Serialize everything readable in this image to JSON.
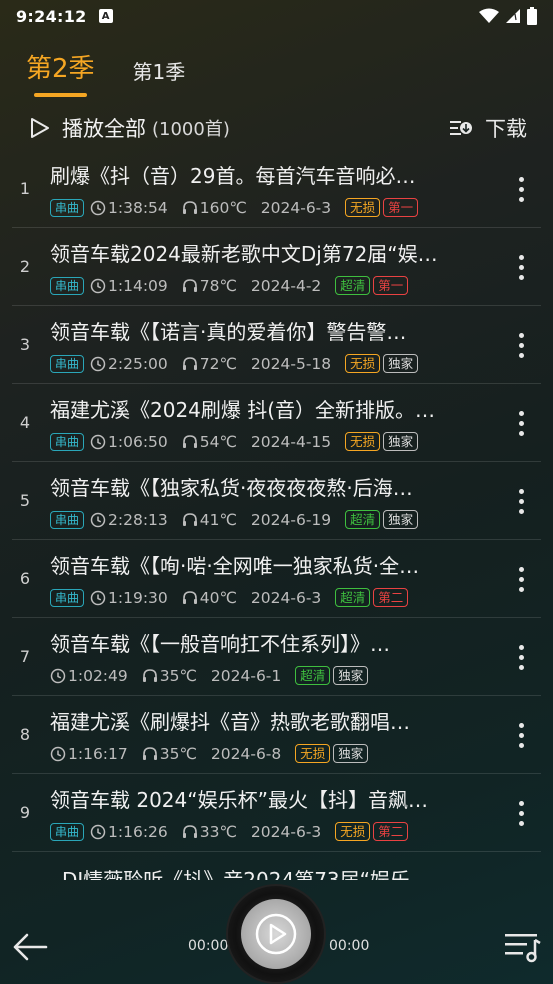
{
  "status": {
    "time": "9:24:12",
    "notif": "A"
  },
  "tabs": [
    {
      "label": "第2季",
      "active": true
    },
    {
      "label": "第1季",
      "active": false
    }
  ],
  "play_all": {
    "label": "播放全部",
    "count": "(1000首)"
  },
  "download": {
    "label": "下载"
  },
  "songs": [
    {
      "index": "1",
      "title": "刷爆《抖（音）29首。每首汽车音响必…",
      "chuan": "串曲",
      "duration": "1:38:54",
      "heat": "160℃",
      "date": "2024-6-3",
      "badges": [
        {
          "text": "无损",
          "kind": "wusun"
        },
        {
          "text": "第一",
          "kind": "red"
        }
      ]
    },
    {
      "index": "2",
      "title": "领音车载2024最新老歌中文Dj第72届“娱…",
      "chuan": "串曲",
      "duration": "1:14:09",
      "heat": "78℃",
      "date": "2024-4-2",
      "badges": [
        {
          "text": "超清",
          "kind": "chaoqing"
        },
        {
          "text": "第一",
          "kind": "red"
        }
      ]
    },
    {
      "index": "3",
      "title": "领音车载《【诺言·真的爱着你】警告警…",
      "chuan": "串曲",
      "duration": "2:25:00",
      "heat": "72℃",
      "date": "2024-5-18",
      "badges": [
        {
          "text": "无损",
          "kind": "wusun"
        },
        {
          "text": "独家",
          "kind": "gray"
        }
      ]
    },
    {
      "index": "4",
      "title": "福建尤溪《2024刷爆 抖(音）全新排版。…",
      "chuan": "串曲",
      "duration": "1:06:50",
      "heat": "54℃",
      "date": "2024-4-15",
      "badges": [
        {
          "text": "无损",
          "kind": "wusun"
        },
        {
          "text": "独家",
          "kind": "gray"
        }
      ]
    },
    {
      "index": "5",
      "title": "领音车载《【独家私货·夜夜夜夜熬·后海…",
      "chuan": "串曲",
      "duration": "2:28:13",
      "heat": "41℃",
      "date": "2024-6-19",
      "badges": [
        {
          "text": "超清",
          "kind": "chaoqing"
        },
        {
          "text": "独家",
          "kind": "gray"
        }
      ]
    },
    {
      "index": "6",
      "title": "领音车载《【咰·啱·全网唯一独家私货·全…",
      "chuan": "串曲",
      "duration": "1:19:30",
      "heat": "40℃",
      "date": "2024-6-3",
      "badges": [
        {
          "text": "超清",
          "kind": "chaoqing"
        },
        {
          "text": "第二",
          "kind": "red"
        }
      ]
    },
    {
      "index": "7",
      "title": "领音车载《【一般音响扛不住系列】》…",
      "chuan": "",
      "duration": "1:02:49",
      "heat": "35℃",
      "date": "2024-6-1",
      "badges": [
        {
          "text": "超清",
          "kind": "chaoqing"
        },
        {
          "text": "独家",
          "kind": "gray"
        }
      ]
    },
    {
      "index": "8",
      "title": "福建尤溪《刷爆抖《音》热歌老歌翻唱…",
      "chuan": "",
      "duration": "1:16:17",
      "heat": "35℃",
      "date": "2024-6-8",
      "badges": [
        {
          "text": "无损",
          "kind": "wusun"
        },
        {
          "text": "独家",
          "kind": "gray"
        }
      ]
    },
    {
      "index": "9",
      "title": "领音车载 2024“娱乐杯”最火【抖】音飙…",
      "chuan": "串曲",
      "duration": "1:16:26",
      "heat": "33℃",
      "date": "2024-6-3",
      "badges": [
        {
          "text": "无损",
          "kind": "wusun"
        },
        {
          "text": "第二",
          "kind": "red"
        }
      ]
    }
  ],
  "partial_title": "DJ情薇聆听《抖》音2024第73届“娱乐…",
  "player": {
    "time_current": "00:00",
    "time_total": "00:00"
  },
  "colors": {
    "accent": "#f5a623",
    "chuan": "#35b8cc",
    "wusun": "#f5a623",
    "chaoqing": "#3fbf3f",
    "red": "#e94242"
  }
}
